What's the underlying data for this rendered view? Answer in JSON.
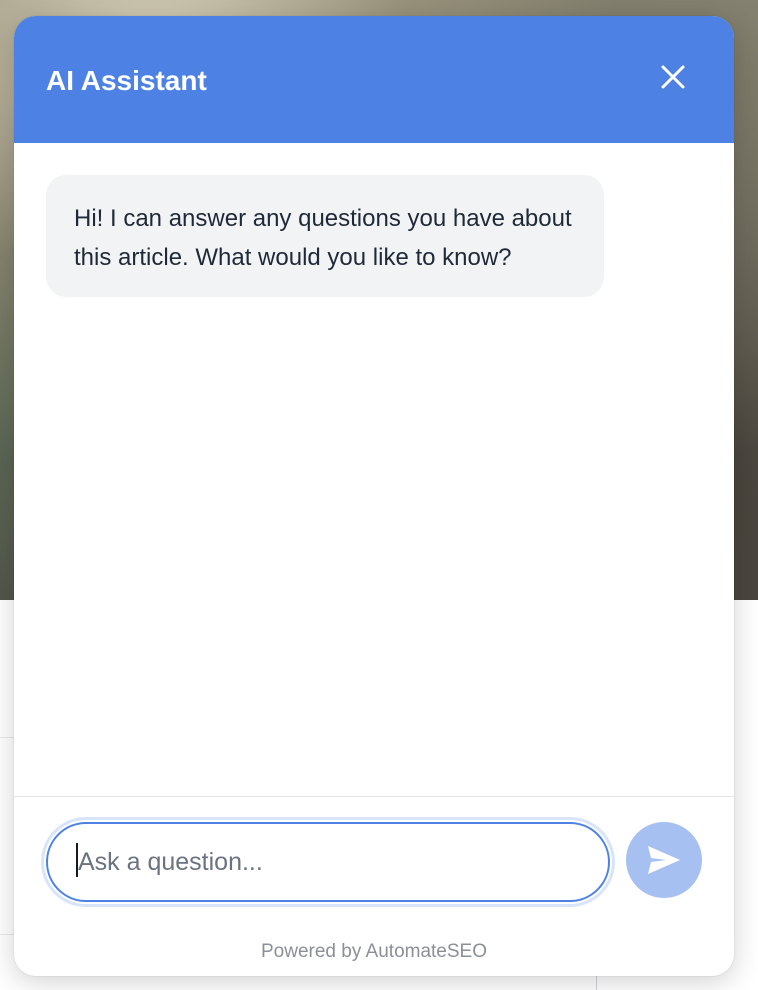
{
  "widget": {
    "title": "AI Assistant",
    "close_icon": "close-icon",
    "accent_color": "#4d82e4"
  },
  "messages": [
    {
      "role": "assistant",
      "text": "Hi! I can answer any questions you have about this article. What would you like to know?"
    }
  ],
  "input": {
    "placeholder": "Ask a question...",
    "value": ""
  },
  "send_button": {
    "icon": "send-icon",
    "state": "disabled",
    "color": "#a6c0f2"
  },
  "footer": {
    "text": "Powered by AutomateSEO"
  }
}
